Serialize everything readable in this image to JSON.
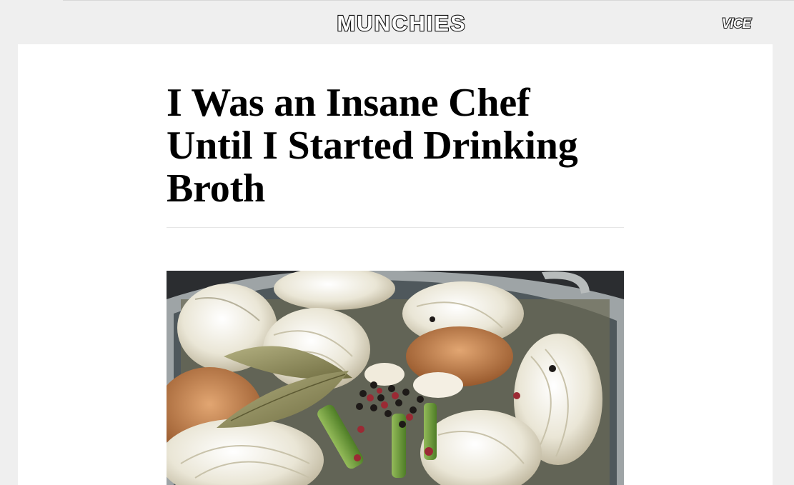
{
  "header": {
    "site_logo": "MUNCHIES",
    "brand_logo": "VICE"
  },
  "article": {
    "headline": "I Was an Insane Chef Until I Started Drinking Broth",
    "hero_image": "broth-pot-photo"
  },
  "colors": {
    "page_bg": "#efefef",
    "card_bg": "#ffffff",
    "text": "#000000"
  }
}
